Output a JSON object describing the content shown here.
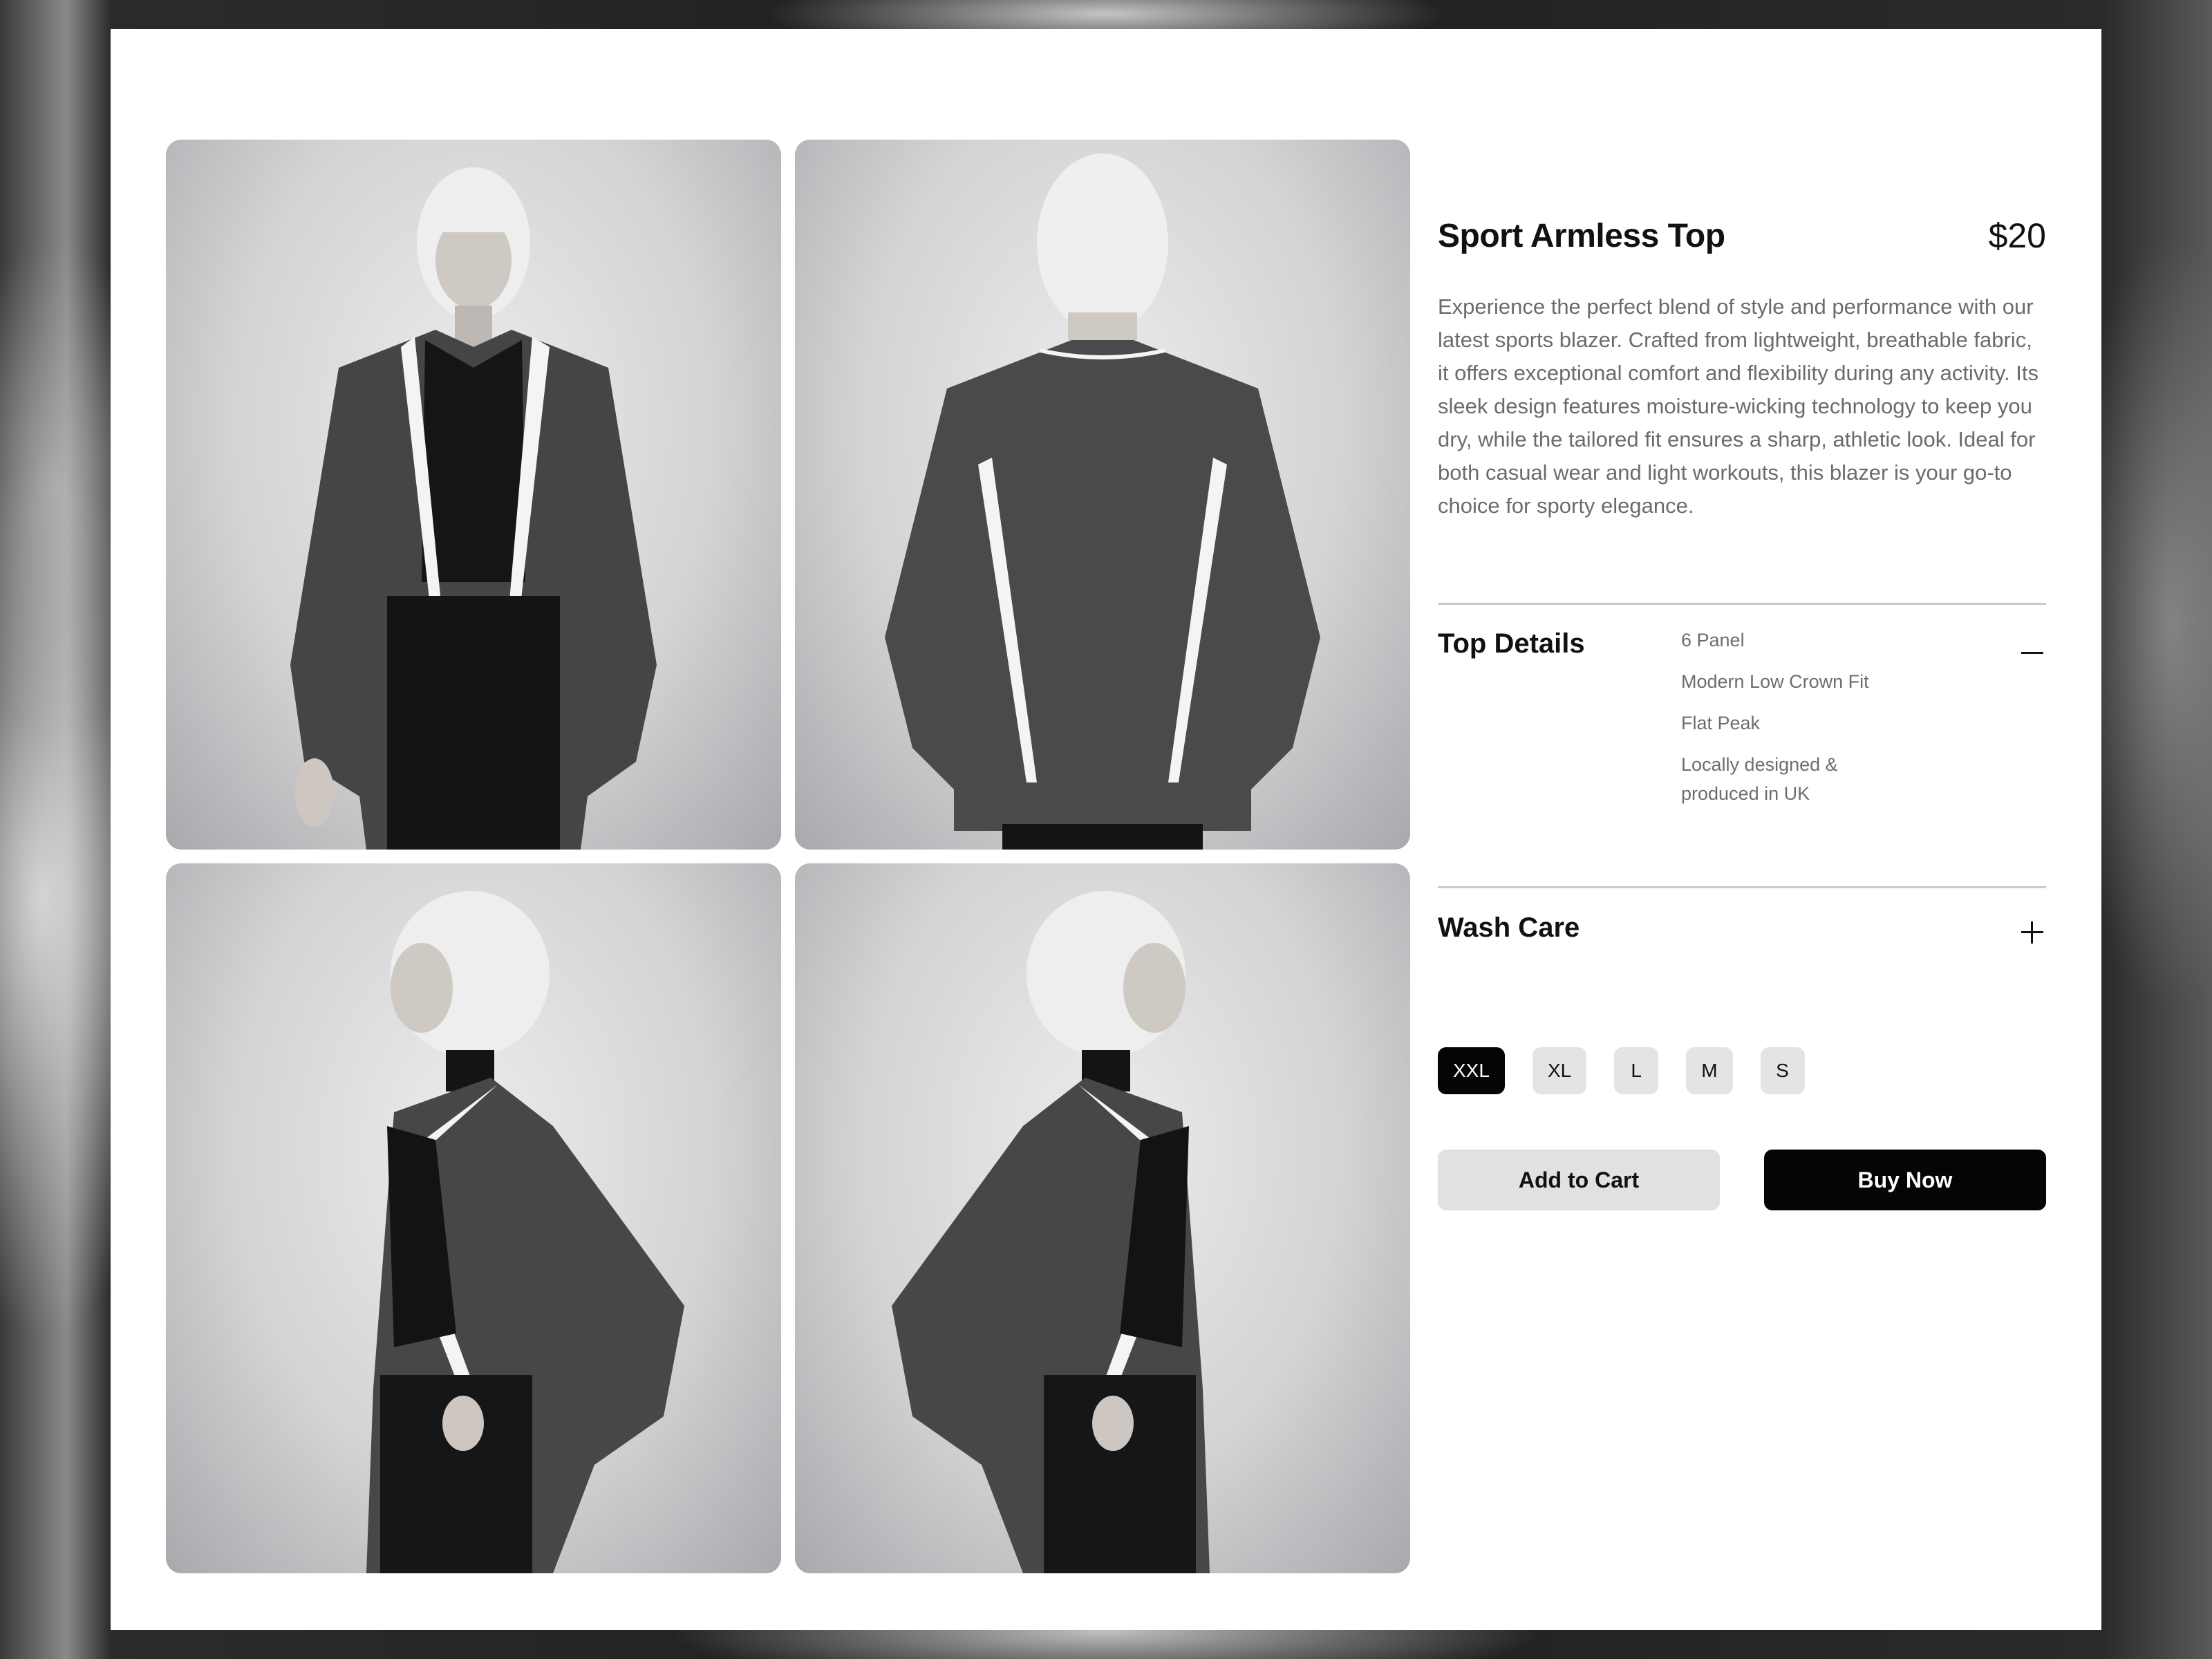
{
  "product": {
    "title": "Sport Armless Top",
    "price": "$20",
    "description": "Experience the perfect blend of style and performance with our latest sports blazer. Crafted from lightweight, breathable fabric, it offers exceptional comfort and flexibility during any activity. Its sleek design features moisture-wicking technology to keep you dry, while the tailored fit ensures a sharp, athletic look. Ideal for both casual wear and light workouts, this blazer is your go-to choice for sporty elegance."
  },
  "gallery": {
    "images": [
      {
        "view": "front"
      },
      {
        "view": "back"
      },
      {
        "view": "left-profile"
      },
      {
        "view": "right-profile"
      }
    ]
  },
  "top_details": {
    "title": "Top Details",
    "expanded": true,
    "items": [
      "6 Panel",
      "Modern Low Crown Fit",
      "Flat Peak",
      "Locally designed & produced in UK"
    ],
    "toggle_icon": "minus-icon"
  },
  "wash_care": {
    "title": "Wash Care",
    "expanded": false,
    "toggle_icon": "plus-icon"
  },
  "sizes": {
    "options": [
      "XXL",
      "XL",
      "L",
      "M",
      "S"
    ],
    "selected": "XXL"
  },
  "actions": {
    "add_to_cart": "Add to Cart",
    "buy_now": "Buy Now"
  },
  "colors": {
    "accent": "#050505",
    "muted_button": "#e1e1e1",
    "body_text": "#6b6b6b"
  }
}
